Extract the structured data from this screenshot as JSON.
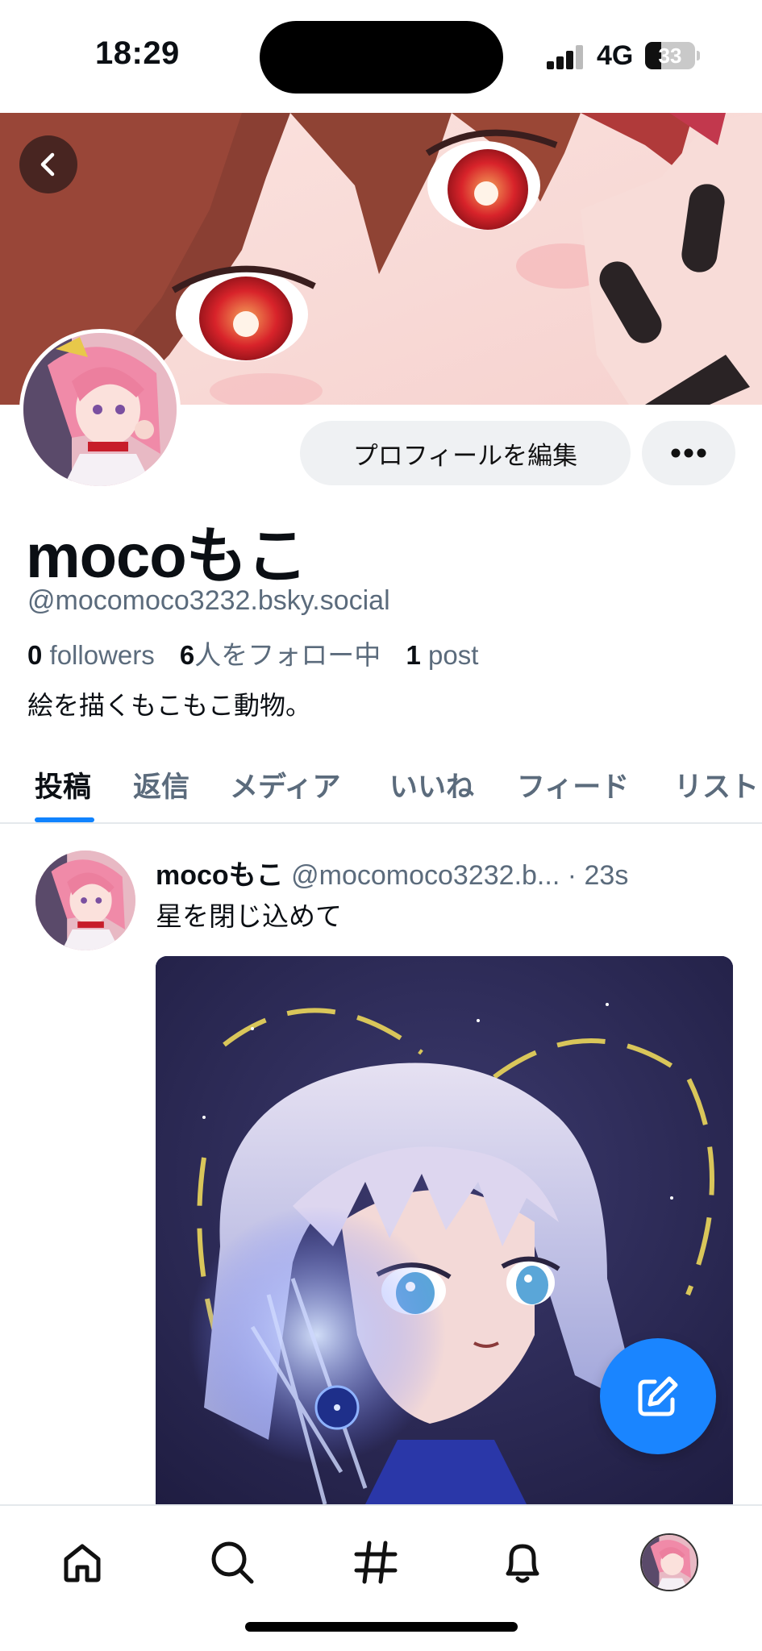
{
  "status_bar": {
    "time": "18:29",
    "network": "4G",
    "battery_text": "33",
    "battery_level": 0.33
  },
  "profile": {
    "display_name": "mocoもこ",
    "handle": "@mocomoco3232.bsky.social",
    "followers_count": "0",
    "followers_label": "followers",
    "following_count": "6",
    "following_label": "人をフォロー中",
    "posts_count": "1",
    "posts_label": "post",
    "bio": "絵を描くもこもこ動物。",
    "edit_button_label": "プロフィールを編集",
    "more_icon": "ellipsis-icon",
    "back_icon": "chevron-left-icon"
  },
  "tabs": [
    {
      "label": "投稿",
      "active": true
    },
    {
      "label": "返信",
      "active": false
    },
    {
      "label": "メディア",
      "active": false
    },
    {
      "label": "いいね",
      "active": false
    },
    {
      "label": "フィード",
      "active": false
    },
    {
      "label": "リスト",
      "active": false
    }
  ],
  "post": {
    "author": "mocoもこ",
    "handle_truncated": "@mocomoco3232.b...",
    "time": "· 23s",
    "text": "星を閉じ込めて"
  },
  "bottom_nav": [
    {
      "icon": "home-icon"
    },
    {
      "icon": "search-icon"
    },
    {
      "icon": "hashtag-icon"
    },
    {
      "icon": "bell-icon"
    },
    {
      "icon": "profile-avatar"
    }
  ],
  "colors": {
    "accent": "#1083fe",
    "fab": "#1a85ff",
    "muted_text": "#5b6b7c",
    "button_bg": "#eff1f3"
  }
}
